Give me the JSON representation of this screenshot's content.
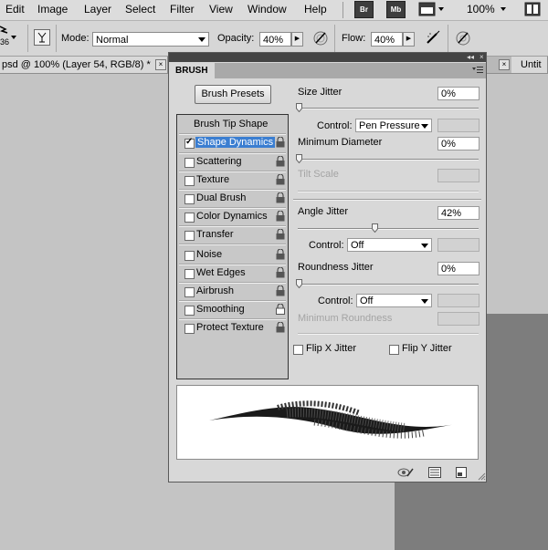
{
  "menu": {
    "items": [
      "Edit",
      "Image",
      "Layer",
      "Select",
      "Filter",
      "View",
      "Window",
      "Help"
    ],
    "bridge_label": "Br",
    "minibridge_label": "Mb",
    "zoom": "100%"
  },
  "options_bar": {
    "brush_size": "36",
    "mode_label": "Mode:",
    "mode_value": "Normal",
    "opacity_label": "Opacity:",
    "opacity_value": "40%",
    "flow_label": "Flow:",
    "flow_value": "40%"
  },
  "document_tabs": {
    "active_tab": "psd @ 100% (Layer 54, RGB/8) *",
    "second_tab": "Untit",
    "close_glyph": "×"
  },
  "brush_panel": {
    "tab_label": "BRUSH",
    "presets_button": "Brush Presets",
    "tip_shape_label": "Brush Tip Shape",
    "options": [
      {
        "label": "Shape Dynamics",
        "checked": true,
        "selected": true
      },
      {
        "label": "Scattering",
        "checked": false
      },
      {
        "label": "Texture",
        "checked": false
      },
      {
        "label": "Dual Brush",
        "checked": false
      },
      {
        "label": "Color Dynamics",
        "checked": false
      },
      {
        "label": "Transfer",
        "checked": false
      },
      {
        "label": "Noise",
        "checked": false
      },
      {
        "label": "Wet Edges",
        "checked": false
      },
      {
        "label": "Airbrush",
        "checked": false
      },
      {
        "label": "Smoothing",
        "checked": false
      },
      {
        "label": "Protect Texture",
        "checked": false
      }
    ],
    "check_glyph": "✓",
    "shape_dynamics": {
      "size_jitter_label": "Size Jitter",
      "size_jitter_value": "0%",
      "size_jitter_fraction": 0.0,
      "control_label": "Control:",
      "size_control_value": "Pen Pressure",
      "min_diameter_label": "Minimum Diameter",
      "min_diameter_value": "0%",
      "min_diameter_fraction": 0.0,
      "tilt_scale_label": "Tilt Scale",
      "angle_jitter_label": "Angle Jitter",
      "angle_jitter_value": "42%",
      "angle_jitter_fraction": 0.42,
      "angle_control_value": "Off",
      "roundness_jitter_label": "Roundness Jitter",
      "roundness_jitter_value": "0%",
      "roundness_jitter_fraction": 0.0,
      "roundness_control_value": "Off",
      "min_roundness_label": "Minimum Roundness",
      "flip_x_label": "Flip X Jitter",
      "flip_y_label": "Flip Y Jitter"
    }
  },
  "colors": {
    "selection_bg": "#3b7ed1",
    "panel_bg": "#d8d8d8",
    "canvas_gray": "#c4c4c4"
  }
}
